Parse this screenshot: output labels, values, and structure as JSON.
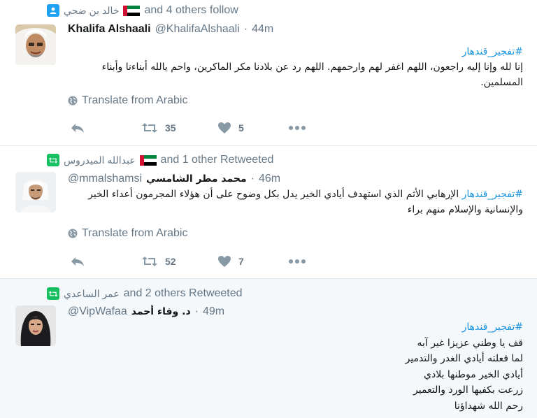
{
  "tweets": [
    {
      "context": {
        "type": "follow",
        "icon": "person-icon",
        "name": "خالد بن ضحي",
        "text": "and 4 others follow"
      },
      "author": {
        "name": "Khalifa Alshaali",
        "handle": "@KhalifaAlshaali",
        "dot": "·",
        "time": "44m"
      },
      "hashtag": "#تفجير_قندهار",
      "text": "إنا لله وإنا إليه راجعون، اللهم اغفر لهم وارحمهم. اللهم رد عن بلادنا مكر الماكرين، واحم يالله أبناءنا وأبناء المسلمين.",
      "translate": "Translate from Arabic",
      "stats": {
        "retweets": "35",
        "likes": "5"
      }
    },
    {
      "context": {
        "type": "retweet",
        "icon": "retweet-icon",
        "name": "عبدالله الميدروس",
        "text": "and 1 other Retweeted"
      },
      "author": {
        "name": "محمد مطر الشامسي",
        "handle": "@mmalshamsi",
        "dot": "·",
        "time": "46m"
      },
      "hashtag": "#تفجير_قندهار",
      "text": "الإرهابي الأثم الذي استهدف أيادي الخير يدل بكل وضوح على أن هؤلاء المجرمون أعداء الخير والإنسانية والإسلام منهم براء",
      "translate": "Translate from Arabic",
      "stats": {
        "retweets": "52",
        "likes": "7"
      }
    },
    {
      "context": {
        "type": "retweet",
        "icon": "retweet-icon",
        "name": "عمر الساعدي",
        "text": "and 2 others Retweeted"
      },
      "author": {
        "name": "د. وفاء أحمد",
        "handle": "@VipWafaa",
        "dot": "·",
        "time": "49m"
      },
      "hashtag": "#تفجير_قندهار",
      "lines": [
        "قف يا وطني عزيزا غير آبه",
        "لما فعلته أيادي الغدر والتدمير",
        "أيادي الخير موطنها بلادي",
        "زرعت بكفيها الورد والتعمير",
        "رحم الله شهداؤنا"
      ]
    }
  ],
  "colors": {
    "link": "#1b95e0",
    "muted": "#657786",
    "follow": "#1da1f2",
    "retweet": "#17bf63"
  },
  "icons": {
    "reply": "reply-icon",
    "retweet": "retweet-icon",
    "like": "heart-icon",
    "more": "more-icon",
    "globe": "globe-icon"
  }
}
